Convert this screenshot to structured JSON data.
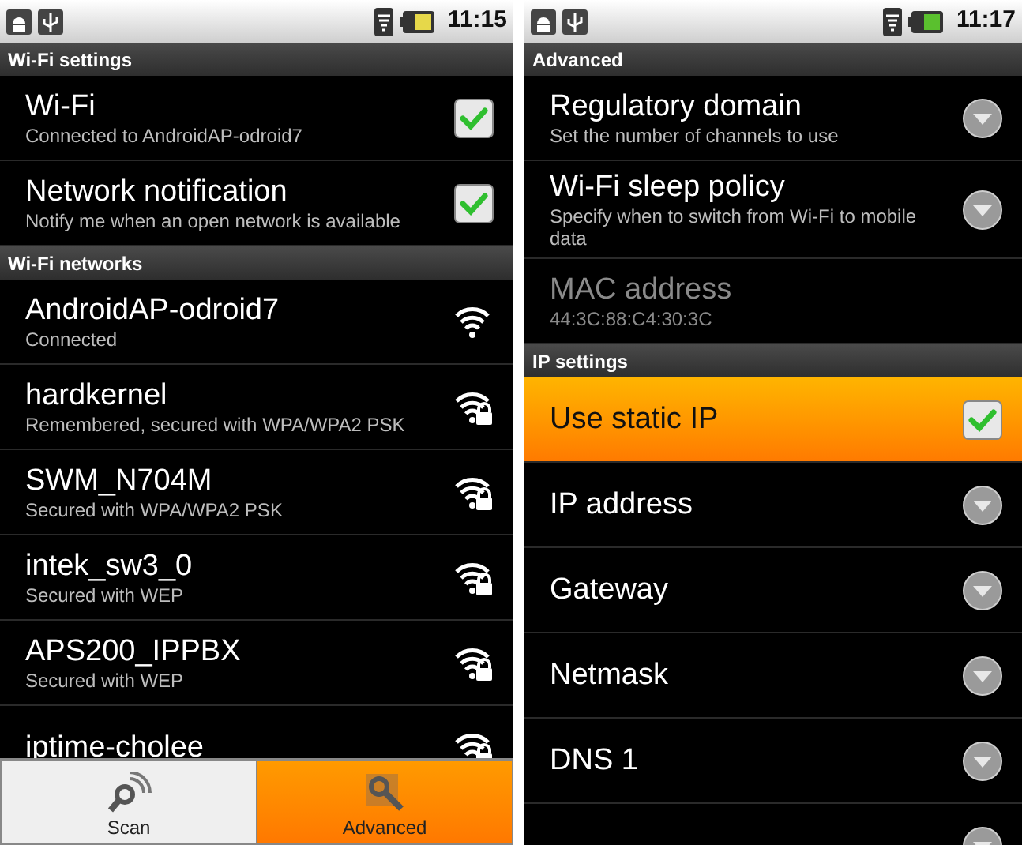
{
  "screens": [
    {
      "status_bar": {
        "time": "11:15"
      },
      "sections": [
        {
          "header": "Wi-Fi settings",
          "items": [
            {
              "kind": "checkbox",
              "title": "Wi-Fi",
              "subtitle": "Connected to AndroidAP-odroid7",
              "checked": true,
              "selected": false,
              "disabled": false
            },
            {
              "kind": "checkbox",
              "title": "Network notification",
              "subtitle": "Notify me when an open network is available",
              "checked": true,
              "selected": false,
              "disabled": false
            }
          ]
        },
        {
          "header": "Wi-Fi networks",
          "items": [
            {
              "kind": "network",
              "title": "AndroidAP-odroid7",
              "subtitle": "Connected",
              "locked": false,
              "selected": false,
              "disabled": false
            },
            {
              "kind": "network",
              "title": "hardkernel",
              "subtitle": "Remembered, secured with WPA/WPA2 PSK",
              "locked": true,
              "selected": false,
              "disabled": false
            },
            {
              "kind": "network",
              "title": "SWM_N704M",
              "subtitle": "Secured with WPA/WPA2 PSK",
              "locked": true,
              "selected": false,
              "disabled": false
            },
            {
              "kind": "network",
              "title": "intek_sw3_0",
              "subtitle": "Secured with WEP",
              "locked": true,
              "selected": false,
              "disabled": false
            },
            {
              "kind": "network",
              "title": "APS200_IPPBX",
              "subtitle": "Secured with WEP",
              "locked": true,
              "selected": false,
              "disabled": false
            },
            {
              "kind": "network",
              "title": "iptime-cholee",
              "locked": true,
              "selected": false,
              "disabled": false
            }
          ]
        }
      ],
      "menu": [
        {
          "label": "Scan",
          "kind": "scan",
          "selected": false
        },
        {
          "label": "Advanced",
          "kind": "tools",
          "selected": true
        }
      ]
    },
    {
      "status_bar": {
        "time": "11:17"
      },
      "sections": [
        {
          "header": "Advanced",
          "items": [
            {
              "kind": "dropdown",
              "title": "Regulatory domain",
              "subtitle": "Set the number of channels to use",
              "selected": false,
              "disabled": false
            },
            {
              "kind": "dropdown",
              "title": "Wi-Fi sleep policy",
              "subtitle": "Specify when to switch from Wi-Fi to mobile data",
              "selected": false,
              "disabled": false
            },
            {
              "kind": "info",
              "title": "MAC address",
              "subtitle": "44:3C:88:C4:30:3C",
              "selected": false,
              "disabled": true
            }
          ]
        },
        {
          "header": "IP settings",
          "items": [
            {
              "kind": "checkbox",
              "title": "Use static IP",
              "checked": true,
              "selected": true,
              "disabled": false
            },
            {
              "kind": "dropdown",
              "title": "IP address",
              "selected": false,
              "disabled": false
            },
            {
              "kind": "dropdown",
              "title": "Gateway",
              "selected": false,
              "disabled": false
            },
            {
              "kind": "dropdown",
              "title": "Netmask",
              "selected": false,
              "disabled": false
            },
            {
              "kind": "dropdown",
              "title": "DNS 1",
              "selected": false,
              "disabled": false
            },
            {
              "kind": "dropdown",
              "selected": false
            }
          ]
        }
      ]
    }
  ]
}
